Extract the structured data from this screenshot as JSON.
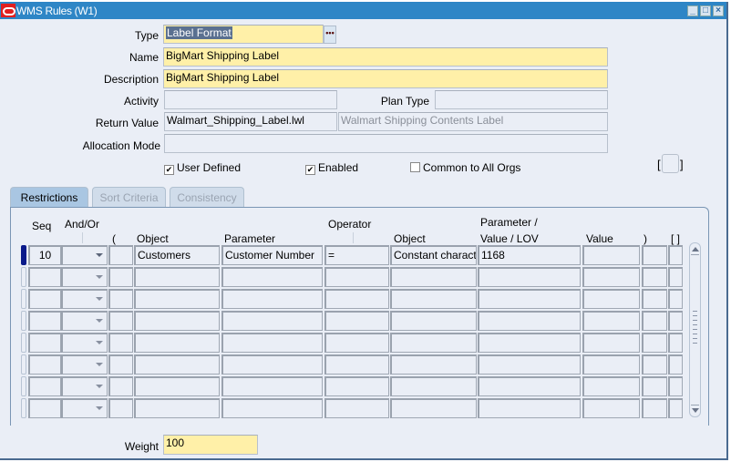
{
  "window": {
    "title": "WMS Rules (W1)",
    "controls": [
      "minimize",
      "maximize",
      "close"
    ]
  },
  "form": {
    "type_label": "Type",
    "type_value": "Label Format",
    "name_label": "Name",
    "name_value": "BigMart Shipping Label",
    "description_label": "Description",
    "description_value": "BigMart Shipping Label",
    "activity_label": "Activity",
    "activity_value": "",
    "plan_type_label": "Plan Type",
    "plan_type_value": "",
    "return_value_label": "Return Value",
    "return_value_value": "Walmart_Shipping_Label.lwl",
    "return_value_desc": "Walmart Shipping Contents Label",
    "allocation_mode_label": "Allocation Mode",
    "allocation_mode_value": "",
    "user_defined_label": "User Defined",
    "user_defined_checked": true,
    "enabled_label": "Enabled",
    "enabled_checked": true,
    "common_label": "Common to All Orgs",
    "common_checked": false,
    "flex_bracket_open": "[",
    "flex_bracket_close": "]",
    "weight_label": "Weight",
    "weight_value": "100"
  },
  "tabs": [
    {
      "label": "Restrictions",
      "active": true
    },
    {
      "label": "Sort Criteria",
      "active": false
    },
    {
      "label": "Consistency",
      "active": false
    }
  ],
  "table": {
    "headers": {
      "seq": "Seq",
      "and_or": "And/Or",
      "open_paren": "(",
      "object": "Object",
      "parameter": "Parameter",
      "operator": "Operator",
      "object2": "Object",
      "param_value_lov_1": "Parameter /",
      "param_value_lov_2": "Value / LOV",
      "value": "Value",
      "close_paren": ")",
      "brackets": "[ ]"
    },
    "rows": [
      {
        "seq": "10",
        "and_or": "",
        "open_paren": "",
        "object": "Customers",
        "parameter": "Customer Number",
        "operator": "=",
        "object2": "Constant character",
        "param_value_lov": "1168",
        "value": "",
        "close_paren": "",
        "flex": ""
      },
      {
        "seq": "",
        "and_or": "",
        "open_paren": "",
        "object": "",
        "parameter": "",
        "operator": "",
        "object2": "",
        "param_value_lov": "",
        "value": "",
        "close_paren": "",
        "flex": ""
      },
      {
        "seq": "",
        "and_or": "",
        "open_paren": "",
        "object": "",
        "parameter": "",
        "operator": "",
        "object2": "",
        "param_value_lov": "",
        "value": "",
        "close_paren": "",
        "flex": ""
      },
      {
        "seq": "",
        "and_or": "",
        "open_paren": "",
        "object": "",
        "parameter": "",
        "operator": "",
        "object2": "",
        "param_value_lov": "",
        "value": "",
        "close_paren": "",
        "flex": ""
      },
      {
        "seq": "",
        "and_or": "",
        "open_paren": "",
        "object": "",
        "parameter": "",
        "operator": "",
        "object2": "",
        "param_value_lov": "",
        "value": "",
        "close_paren": "",
        "flex": ""
      },
      {
        "seq": "",
        "and_or": "",
        "open_paren": "",
        "object": "",
        "parameter": "",
        "operator": "",
        "object2": "",
        "param_value_lov": "",
        "value": "",
        "close_paren": "",
        "flex": ""
      },
      {
        "seq": "",
        "and_or": "",
        "open_paren": "",
        "object": "",
        "parameter": "",
        "operator": "",
        "object2": "",
        "param_value_lov": "",
        "value": "",
        "close_paren": "",
        "flex": ""
      },
      {
        "seq": "",
        "and_or": "",
        "open_paren": "",
        "object": "",
        "parameter": "",
        "operator": "",
        "object2": "",
        "param_value_lov": "",
        "value": "",
        "close_paren": "",
        "flex": ""
      }
    ]
  },
  "icons": {
    "lov_button": "ellipsis-icon",
    "scroll_up": "arrow-up-icon",
    "scroll_down": "arrow-down-icon"
  },
  "colors": {
    "titlebar": "#2e86c6",
    "required_field": "#fff0a8",
    "background": "#eaeef6",
    "current_record": "#0a1a8a"
  }
}
